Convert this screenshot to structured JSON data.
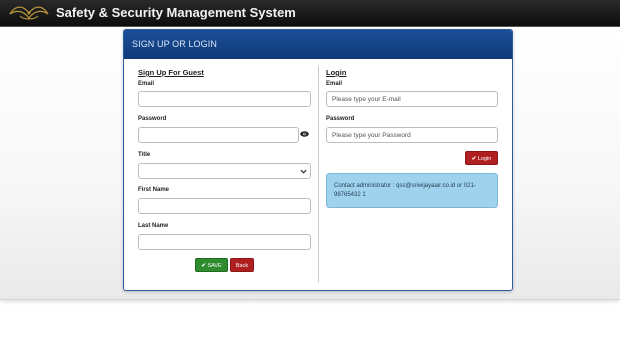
{
  "app": {
    "title": "Safety & Security Management System"
  },
  "panel": {
    "header": "SIGN UP OR LOGIN"
  },
  "signup": {
    "section_title": "Sign Up For Guest",
    "email_label": "Email",
    "email_value": "",
    "password_label": "Password",
    "password_value": "",
    "title_label": "Title",
    "title_value": "",
    "first_name_label": "First Name",
    "first_name_value": "",
    "last_name_label": "Last Name",
    "last_name_value": "",
    "save_label": "SAVE",
    "back_label": "Back"
  },
  "login": {
    "section_title": "Login",
    "email_label": "Email",
    "email_placeholder": "Please type your E-mail",
    "password_label": "Password",
    "password_placeholder": "Please type your Password",
    "login_label": "Login"
  },
  "contact": {
    "text": "Contact administrator : qss@sriwijayaair.co.id or 021-98765432 1"
  },
  "colors": {
    "header": "#1b4f98",
    "save": "#2e8b2e",
    "danger": "#b02020",
    "note": "#9fd2ec"
  },
  "icons": {
    "logo": "ornament-logo",
    "eye": "eye-icon",
    "check": "check-icon",
    "select": "chevron-down-icon"
  }
}
